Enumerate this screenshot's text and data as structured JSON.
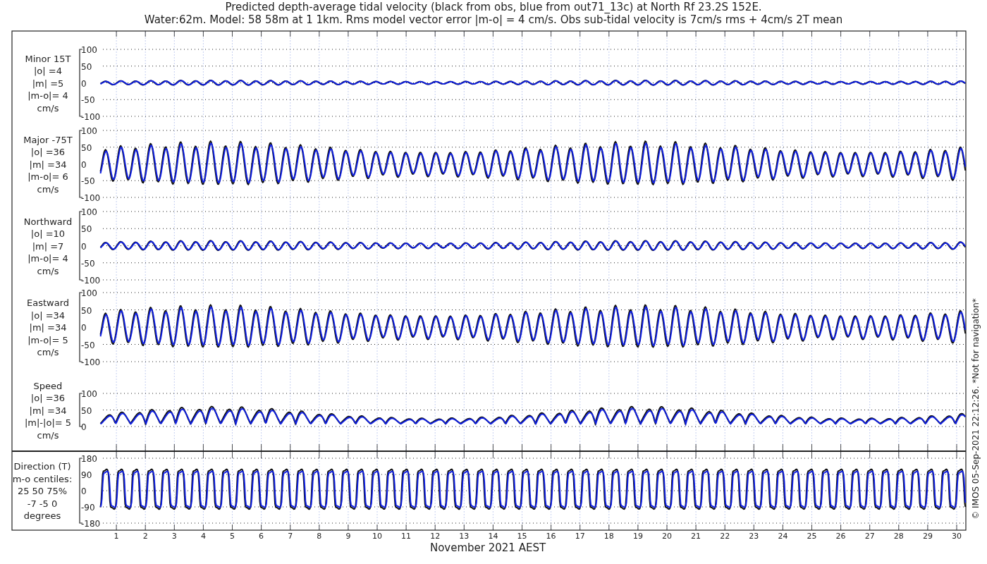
{
  "title": "Predicted depth-average tidal velocity (black from obs, blue from out71_13c) at North Rf 23.2S 152E.",
  "subtitle": "Water:62m. Model: 58 58m at 1 1km. Rms model vector error |m-o| = 4 cm/s. Obs sub-tidal velocity is 7cm/s rms + 4cm/s 2T mean",
  "panels": [
    {
      "kind": "velocity",
      "label_lines": [
        "Minor 15T",
        "|o| =4",
        "|m| =5",
        "|m-o|= 4",
        "cm/s"
      ],
      "yticks": [
        "100",
        "50",
        "0",
        "-50",
        "-100"
      ]
    },
    {
      "kind": "velocity",
      "label_lines": [
        "Major -75T",
        "|o| =36",
        "|m| =34",
        "|m-o|= 6",
        "cm/s"
      ],
      "yticks": [
        "100",
        "50",
        "0",
        "-50",
        "-100"
      ]
    },
    {
      "kind": "velocity",
      "label_lines": [
        "Northward",
        "|o| =10",
        "|m| =7",
        "|m-o|= 4",
        "cm/s"
      ],
      "yticks": [
        "100",
        "50",
        "0",
        "-50",
        "-100"
      ]
    },
    {
      "kind": "velocity",
      "label_lines": [
        "Eastward",
        "|o| =34",
        "|m| =34",
        "|m-o|= 5",
        "cm/s"
      ],
      "yticks": [
        "100",
        "50",
        "0",
        "-50",
        "-100"
      ]
    },
    {
      "kind": "speed",
      "label_lines": [
        "Speed",
        "|o| =36",
        "|m| =34",
        "|m|-|o|= 5",
        "cm/s"
      ],
      "yticks": [
        "100",
        "50",
        "0"
      ]
    },
    {
      "kind": "direction",
      "label_lines": [
        "Direction (T)",
        "m-o centiles:",
        "25  50  75%",
        "-7 -5  0",
        "degrees"
      ],
      "yticks": [
        "180",
        "90",
        "0",
        "-90",
        "-180"
      ]
    }
  ],
  "x_axis": {
    "ticks": [
      "1",
      "2",
      "3",
      "4",
      "5",
      "6",
      "7",
      "8",
      "9",
      "10",
      "11",
      "12",
      "13",
      "14",
      "15",
      "16",
      "17",
      "18",
      "19",
      "20",
      "21",
      "22",
      "23",
      "24",
      "25",
      "26",
      "27",
      "28",
      "29",
      "30"
    ],
    "label": "November 2021 AEST"
  },
  "footer_note": "© IMOS 05-Sep-2021 22:12:26. *Not for navigation*"
}
